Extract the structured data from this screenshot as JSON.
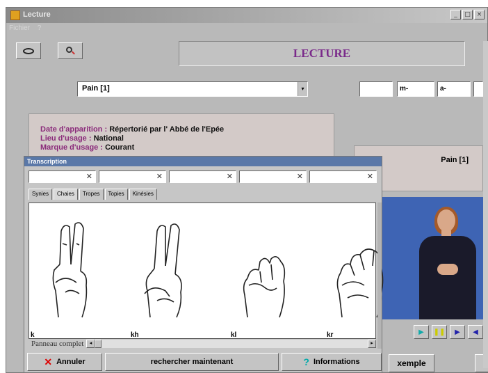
{
  "window": {
    "title": "Lecture",
    "controls": [
      "_",
      "□",
      "×"
    ]
  },
  "menu": [
    "Fichier",
    "?"
  ],
  "toolbar": {
    "view_icon": "eye-icon",
    "search_icon": "magnifier-icon"
  },
  "header": {
    "title": "LECTURE"
  },
  "sign_select": {
    "value": "Pain [1]",
    "arrow": "▾"
  },
  "small_fields": [
    "",
    "m-",
    "a-",
    ""
  ],
  "info": {
    "rows": [
      {
        "key": "Date d'apparition",
        "sep": " : ",
        "value": "Répertorié par l' Abbé de l'Epée"
      },
      {
        "key": "Lieu d'usage",
        "sep": " : ",
        "value": "National"
      },
      {
        "key": "Marque d'usage",
        "sep": " : ",
        "value": "Courant"
      }
    ]
  },
  "sign_panel": {
    "name": "Pain [1]"
  },
  "video": {
    "controls": [
      "▶",
      "❚❚",
      "▶",
      "◀"
    ]
  },
  "exemple_button": "xemple",
  "dialog": {
    "title": "Transcription",
    "fields": [
      {
        "value": "",
        "clear": "✕"
      },
      {
        "value": "",
        "clear": "✕"
      },
      {
        "value": "",
        "clear": "✕"
      },
      {
        "value": "",
        "clear": "✕"
      },
      {
        "value": "",
        "clear": "✕"
      }
    ],
    "tabs": [
      "Synies",
      "Chaies",
      "Tropes",
      "Topies",
      "Kinésies"
    ],
    "active_tab": "Chaies",
    "handshapes": [
      "k",
      "kh",
      "kl",
      "kr"
    ],
    "scroll_label": "Panneau complet",
    "buttons": {
      "cancel": "Annuler",
      "search": "rechercher maintenant",
      "info": "Informations"
    }
  },
  "colors": {
    "accent_purple": "#7a2a8a",
    "title_bar": "#5a78a8",
    "video_bg": "#3e64b4"
  }
}
